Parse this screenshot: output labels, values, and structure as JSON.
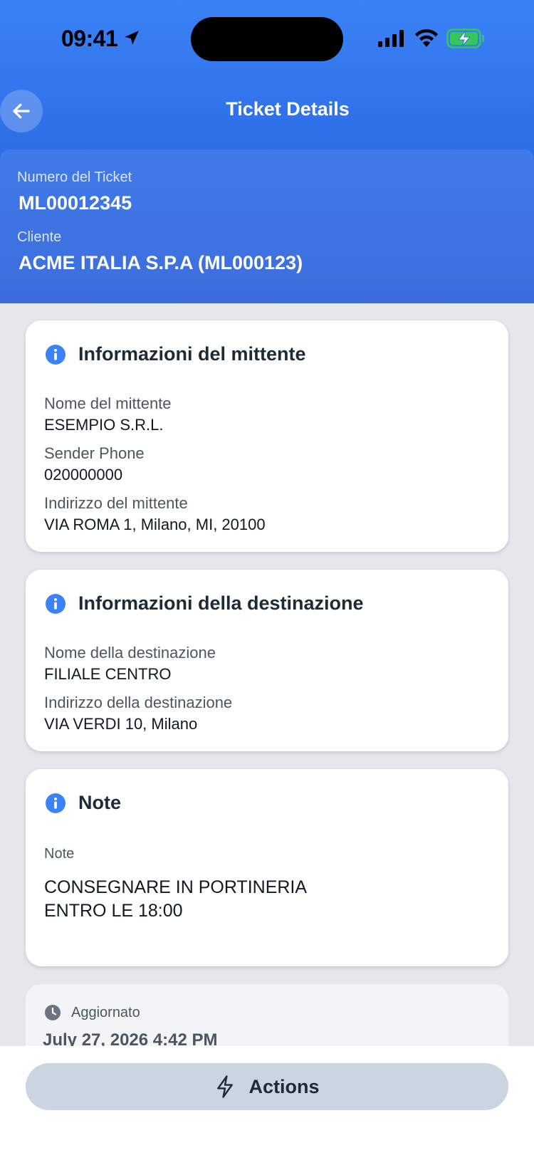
{
  "status_bar": {
    "time": "09:41",
    "icons": [
      "location-arrow-icon",
      "signal-icon",
      "wifi-icon",
      "battery-charging-icon"
    ],
    "battery_color": "#34c759"
  },
  "header": {
    "title": "Ticket Details",
    "back_icon": "arrow-left-icon",
    "ticket_number_label": "Numero del Ticket",
    "ticket_number": "ML00012345",
    "client_label": "Cliente",
    "client": "ACME ITALIA S.P.A (ML000123)",
    "accent": "#2f6fe8"
  },
  "sender": {
    "title": "Informazioni del mittente",
    "name_label": "Nome del mittente",
    "name": "ESEMPIO S.R.L.",
    "phone_label": "Sender Phone",
    "phone": "020000000",
    "address_label": "Indirizzo del mittente",
    "address": "VIA ROMA 1, Milano, MI, 20100"
  },
  "destination": {
    "title": "Informazioni della destinazione",
    "name_label": "Nome della destinazione",
    "name": "FILIALE CENTRO",
    "address_label": "Indirizzo della destinazione",
    "address": "VIA VERDI 10, Milano"
  },
  "notes": {
    "title": "Note",
    "label": "Note",
    "text": "CONSEGNARE IN PORTINERIA\nENTRO LE 18:00"
  },
  "updated": {
    "label": "Aggiornato",
    "value": "July 27, 2026 4:42 PM"
  },
  "actions": {
    "label": "Actions",
    "icon": "bolt-icon"
  }
}
